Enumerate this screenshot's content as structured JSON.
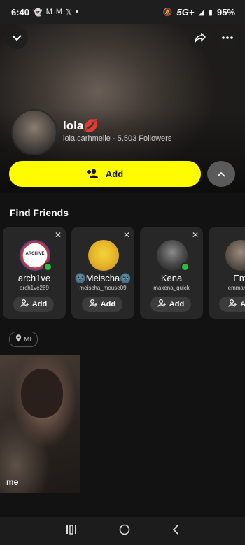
{
  "status_bar": {
    "time": "6:40",
    "notification_icons": [
      "snapchat-ghost-icon",
      "gmail-icon",
      "gmail-icon",
      "x-icon",
      "dot-icon"
    ],
    "network": "5G+",
    "battery": "95%"
  },
  "header": {
    "collapse_icon": "chevron-down-icon",
    "share_icon": "share-icon",
    "more_icon": "more-icon"
  },
  "profile": {
    "name": "lola💋",
    "username": "lola.carhmelle",
    "followers": "5,503 Followers",
    "separator": "·"
  },
  "actions": {
    "add_label": "Add"
  },
  "find_friends": {
    "title": "Find Friends",
    "cards": [
      {
        "name": "arch1ve",
        "username": "arch1ve269",
        "add_label": "Add",
        "online": true,
        "badge_text": "ARCHIVE"
      },
      {
        "name": "🌚Meischa🌚",
        "username": "meischa_mouse09",
        "add_label": "Add",
        "online": false
      },
      {
        "name": "Kena",
        "username": "makena_quick",
        "add_label": "Add",
        "online": true
      },
      {
        "name": "Em",
        "username": "emmarilej",
        "add_label": "Ad",
        "online": false
      }
    ]
  },
  "location": {
    "label": "MI"
  },
  "stories": [
    {
      "label": "me"
    }
  ],
  "colors": {
    "accent": "#fffc00",
    "online": "#20c340",
    "card_bg": "#272727"
  }
}
